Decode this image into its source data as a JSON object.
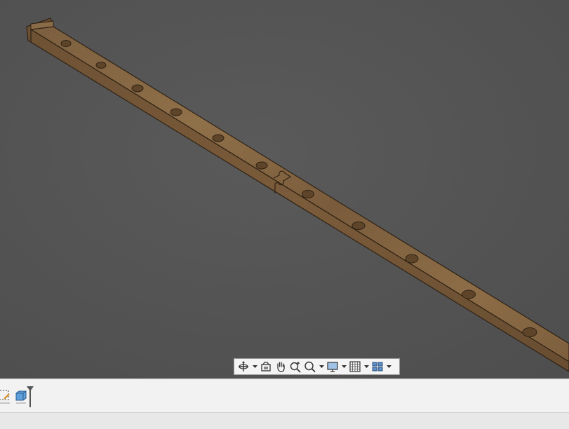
{
  "viewport": {
    "background": "#555555",
    "model": {
      "name": "rail",
      "wood_color": "#8a6a45",
      "edge_color": "#3a2a18",
      "hole_count": 12,
      "joint_count": 1
    }
  },
  "nav_toolbar": {
    "tools": [
      {
        "icon": "orbit-icon",
        "has_menu": true
      },
      {
        "icon": "look-at-icon",
        "has_menu": false
      },
      {
        "icon": "pan-icon",
        "has_menu": false
      },
      {
        "icon": "zoom-icon",
        "has_menu": false
      },
      {
        "icon": "zoom-window-icon",
        "has_menu": true
      },
      {
        "icon": "display-settings-icon",
        "has_menu": true
      },
      {
        "icon": "grid-snap-icon",
        "has_menu": true
      },
      {
        "icon": "viewports-icon",
        "has_menu": true
      }
    ]
  },
  "timeline": {
    "items": [
      "sketch-feature-icon",
      "extrude-feature-icon",
      "timeline-marker-icon"
    ]
  }
}
